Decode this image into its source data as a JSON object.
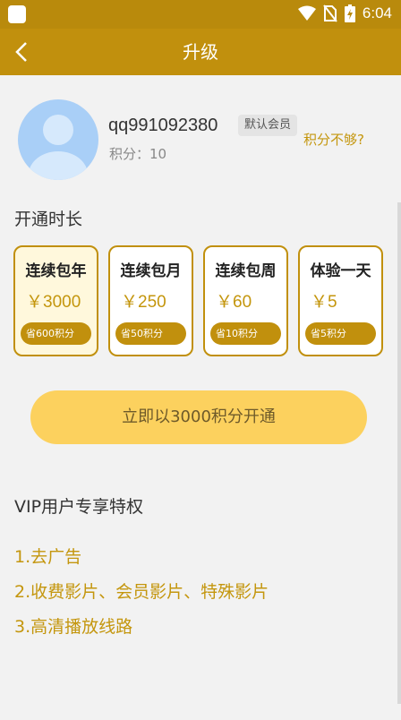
{
  "status_bar": {
    "time": "6:04",
    "icons": [
      "app-icon",
      "wifi-icon",
      "no-sim-icon",
      "battery-charging-icon"
    ]
  },
  "header": {
    "title": "升级",
    "back_icon": "back-arrow-icon"
  },
  "user": {
    "username": "qq991092380",
    "badge": "默认会员",
    "points_label": "积分：10",
    "points_link": "积分不够?"
  },
  "duration": {
    "title": "开通时长",
    "plans": [
      {
        "name": "连续包年",
        "price": "￥3000",
        "save": "省600积分",
        "selected": true
      },
      {
        "name": "连续包月",
        "price": "￥250",
        "save": "省50积分",
        "selected": false
      },
      {
        "name": "连续包周",
        "price": "￥60",
        "save": "省10积分",
        "selected": false
      },
      {
        "name": "体验一天",
        "price": "￥5",
        "save": "省5积分",
        "selected": false
      }
    ]
  },
  "cta": {
    "label": "立即以3000积分开通"
  },
  "privileges": {
    "title": "VIP用户专享特权",
    "items": [
      "1.去广告",
      "2.收费影片、会员影片、特殊影片",
      "3.高清播放线路"
    ]
  },
  "colors": {
    "primary": "#c1900d",
    "status_bar": "#b98a0c",
    "accent_text": "#c4960d",
    "cta": "#fcd15e",
    "selected_plan_bg": "#fff8dc"
  }
}
